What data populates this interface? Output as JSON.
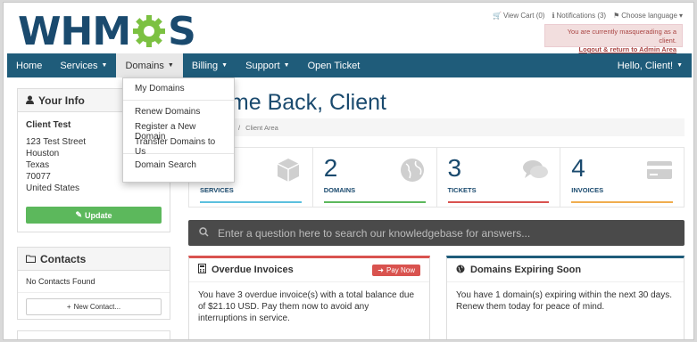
{
  "brand": {
    "logo_left": "WHM",
    "logo_right": "S"
  },
  "topbar": {
    "view_cart": "View Cart (0)",
    "notifications": "Notifications (3)",
    "choose_language": "Choose language"
  },
  "masquerade": {
    "notice": "You are currently masquerading as a client.",
    "link": "Logout & return to Admin Area"
  },
  "nav": {
    "home": "Home",
    "services": "Services",
    "domains": "Domains",
    "billing": "Billing",
    "support": "Support",
    "open_ticket": "Open Ticket",
    "hello": "Hello, Client!"
  },
  "domains_menu": {
    "my_domains": "My Domains",
    "renew": "Renew Domains",
    "register": "Register a New Domain",
    "transfer": "Transfer Domains to Us",
    "search": "Domain Search"
  },
  "your_info": {
    "title": "Your Info",
    "name": "Client Test",
    "address1": "123 Test Street",
    "city": "Houston",
    "state": "Texas",
    "zip": "70077",
    "country": "United States",
    "update": "Update"
  },
  "contacts": {
    "title": "Contacts",
    "empty": "No Contacts Found",
    "new": "New Contact..."
  },
  "main": {
    "welcome": "ome Back, Client",
    "breadcrumb_sep": "/",
    "breadcrumb_current": "Client Area"
  },
  "tiles": [
    {
      "num": "1",
      "label": "SERVICES",
      "color": "#5bc0de"
    },
    {
      "num": "2",
      "label": "DOMAINS",
      "color": "#5cb85c"
    },
    {
      "num": "3",
      "label": "TICKETS",
      "color": "#d9534f"
    },
    {
      "num": "4",
      "label": "INVOICES",
      "color": "#f0ad4e"
    }
  ],
  "kb_search": {
    "placeholder": "Enter a question here to search our knowledgebase for answers..."
  },
  "overdue": {
    "title": "Overdue Invoices",
    "pay_now": "Pay Now",
    "text": "You have 3 overdue invoice(s) with a total balance due of $21.10 USD. Pay them now to avoid any interruptions in service."
  },
  "expiring": {
    "title": "Domains Expiring Soon",
    "text": "You have 1 domain(s) expiring within the next 30 days. Renew them today for peace of mind."
  },
  "colors": {
    "nav": "#1f5c7a",
    "brand": "#1a4a6e",
    "gear": "#7cc142",
    "pay": "#d9534f"
  }
}
